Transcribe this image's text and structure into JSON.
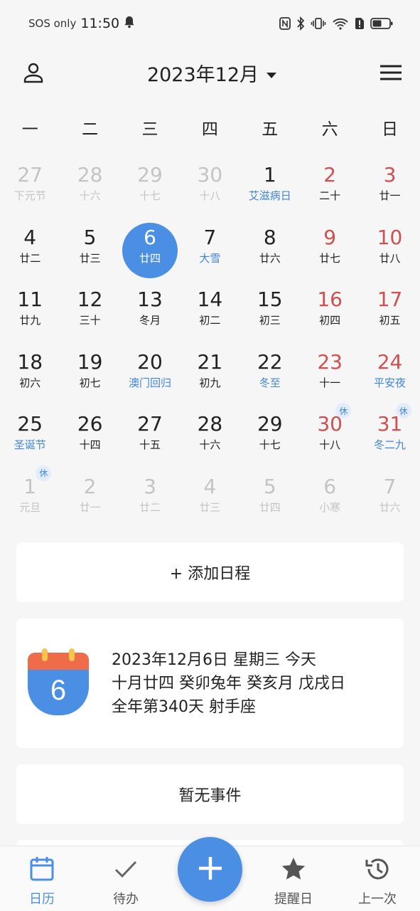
{
  "status": {
    "carrier": "SOS only",
    "time": "11:50"
  },
  "header": {
    "title": "2023年12月"
  },
  "weekdays": [
    "一",
    "二",
    "三",
    "四",
    "五",
    "六",
    "日"
  ],
  "days": [
    {
      "n": "27",
      "s": "下元节",
      "other": true,
      "fest": true
    },
    {
      "n": "28",
      "s": "十六",
      "other": true
    },
    {
      "n": "29",
      "s": "十七",
      "other": true
    },
    {
      "n": "30",
      "s": "十八",
      "other": true
    },
    {
      "n": "1",
      "s": "艾滋病日",
      "fest": true
    },
    {
      "n": "2",
      "s": "二十",
      "weekend": true
    },
    {
      "n": "3",
      "s": "廿一",
      "weekend": true
    },
    {
      "n": "4",
      "s": "廿二"
    },
    {
      "n": "5",
      "s": "廿三"
    },
    {
      "n": "6",
      "s": "廿四",
      "selected": true
    },
    {
      "n": "7",
      "s": "大雪",
      "fest": true
    },
    {
      "n": "8",
      "s": "廿六"
    },
    {
      "n": "9",
      "s": "廿七",
      "weekend": true
    },
    {
      "n": "10",
      "s": "廿八",
      "weekend": true
    },
    {
      "n": "11",
      "s": "廿九"
    },
    {
      "n": "12",
      "s": "三十"
    },
    {
      "n": "13",
      "s": "冬月"
    },
    {
      "n": "14",
      "s": "初二"
    },
    {
      "n": "15",
      "s": "初三"
    },
    {
      "n": "16",
      "s": "初四",
      "weekend": true
    },
    {
      "n": "17",
      "s": "初五",
      "weekend": true
    },
    {
      "n": "18",
      "s": "初六"
    },
    {
      "n": "19",
      "s": "初七"
    },
    {
      "n": "20",
      "s": "澳门回归",
      "fest": true
    },
    {
      "n": "21",
      "s": "初九"
    },
    {
      "n": "22",
      "s": "冬至",
      "fest": true
    },
    {
      "n": "23",
      "s": "十一",
      "weekend": true
    },
    {
      "n": "24",
      "s": "平安夜",
      "weekend": true,
      "fest": true
    },
    {
      "n": "25",
      "s": "圣诞节",
      "fest": true
    },
    {
      "n": "26",
      "s": "十四"
    },
    {
      "n": "27",
      "s": "十五"
    },
    {
      "n": "28",
      "s": "十六"
    },
    {
      "n": "29",
      "s": "十七"
    },
    {
      "n": "30",
      "s": "十八",
      "weekend": true,
      "badge": "休"
    },
    {
      "n": "31",
      "s": "冬二九",
      "weekend": true,
      "fest": true,
      "badge": "休"
    },
    {
      "n": "1",
      "s": "元旦",
      "other": true,
      "badge": "休"
    },
    {
      "n": "2",
      "s": "廿一",
      "other": true
    },
    {
      "n": "3",
      "s": "廿二",
      "other": true
    },
    {
      "n": "4",
      "s": "廿三",
      "other": true
    },
    {
      "n": "5",
      "s": "廿四",
      "other": true
    },
    {
      "n": "6",
      "s": "小寒",
      "other": true
    },
    {
      "n": "7",
      "s": "廿六",
      "other": true
    }
  ],
  "add_schedule": "+ 添加日程",
  "today_info": {
    "icon_day": "6",
    "line1": "2023年12月6日 星期三 今天",
    "line2": "十月廿四 癸卯兔年 癸亥月 戊戌日",
    "line3": "全年第340天 射手座"
  },
  "empty_events": "暂无事件",
  "nav": {
    "calendar": "日历",
    "todo": "待办",
    "reminder": "提醒日",
    "last": "上一次"
  },
  "colors": {
    "accent": "#4a8fe4",
    "weekend": "#d05050",
    "festival": "#3f86d8"
  }
}
